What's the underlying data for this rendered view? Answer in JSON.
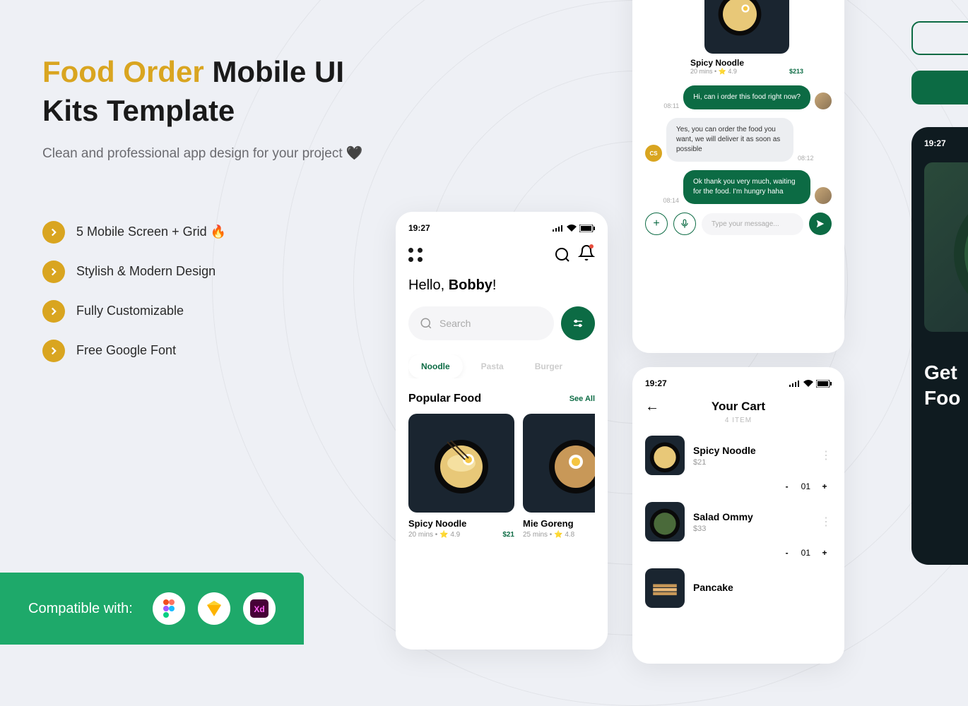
{
  "hero": {
    "title_accent": "Food Order",
    "title_rest": " Mobile UI Kits Template",
    "subtitle": "Clean and professional app design for your project 🖤"
  },
  "features": [
    "5 Mobile Screen + Grid 🔥",
    "Stylish & Modern Design",
    "Fully Customizable",
    "Free Google Font"
  ],
  "compat": {
    "label": "Compatible with:"
  },
  "home": {
    "time": "19:27",
    "greeting_pre": "Hello, ",
    "greeting_name": "Bobby",
    "greeting_post": "!",
    "search_placeholder": "Search",
    "chips": [
      "Noodle",
      "Pasta",
      "Burger"
    ],
    "section_title": "Popular Food",
    "see_all": "See All",
    "cards": [
      {
        "name": "Spicy Noodle",
        "time": "20 mins",
        "rating": "4.9",
        "price": "$21"
      },
      {
        "name": "Mie Goreng",
        "time": "25 mins",
        "rating": "4.8",
        "price": ""
      }
    ]
  },
  "chat": {
    "food": {
      "name": "Spicy Noodle",
      "time": "20 mins",
      "rating": "4.9",
      "price": "$213"
    },
    "msgs": [
      {
        "time": "08:11",
        "text": "Hi, can i order this food right now?",
        "side": "right"
      },
      {
        "time": "08:12",
        "text": "Yes,   you can order the food you want, we will deliver it as soon as possible",
        "side": "left",
        "initials": "CS"
      },
      {
        "time": "08:14",
        "text": "Ok thank you very much, waiting for the food. I'm hungry haha",
        "side": "right"
      }
    ],
    "input_placeholder": "Type your message..."
  },
  "cart": {
    "time": "19:27",
    "title": "Your Cart",
    "count": "4 ITEM",
    "items": [
      {
        "name": "Spicy Noodle",
        "price": "$21",
        "qty": "01"
      },
      {
        "name": "Salad Ommy",
        "price": "$33",
        "qty": "01"
      },
      {
        "name": "Pancake",
        "price": "",
        "qty": ""
      }
    ]
  },
  "dark": {
    "time": "19:27",
    "headline_l1": "Get",
    "headline_l2": "Foo"
  }
}
